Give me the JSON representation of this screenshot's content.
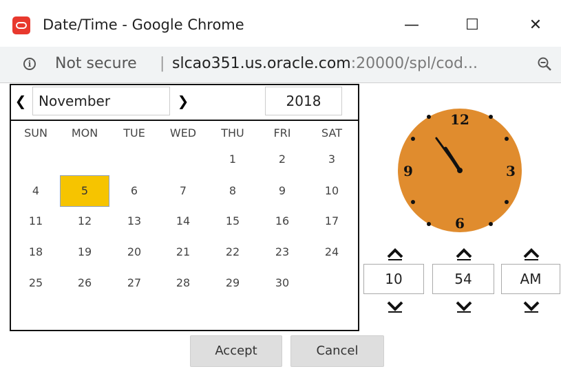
{
  "window": {
    "title": "Date/Time - Google Chrome",
    "minimize_glyph": "—",
    "maximize_glyph": "☐",
    "close_glyph": "✕"
  },
  "address": {
    "security_text": "Not secure",
    "separator": "|",
    "url_host": "slcao351.us.oracle.com",
    "url_rest": ":20000/spl/cod..."
  },
  "calendar": {
    "month": "November",
    "year": "2018",
    "prev_glyph": "❮",
    "next_glyph": "❯",
    "weekdays": [
      "SUN",
      "MON",
      "TUE",
      "WED",
      "THU",
      "FRI",
      "SAT"
    ],
    "weeks": [
      [
        "",
        "",
        "",
        "",
        "1",
        "2",
        "3"
      ],
      [
        "4",
        "5",
        "6",
        "7",
        "8",
        "9",
        "10"
      ],
      [
        "11",
        "12",
        "13",
        "14",
        "15",
        "16",
        "17"
      ],
      [
        "18",
        "19",
        "20",
        "21",
        "22",
        "23",
        "24"
      ],
      [
        "25",
        "26",
        "27",
        "28",
        "29",
        "30",
        ""
      ]
    ],
    "selected_day": "5",
    "selected_color": "#f6c400"
  },
  "clock": {
    "face_color": "#e08c2e",
    "numerals": {
      "twelve": "12",
      "three": "3",
      "six": "6",
      "nine": "9"
    },
    "hour": 10,
    "minute": 54
  },
  "time": {
    "hour": "10",
    "minute": "54",
    "ampm": "AM"
  },
  "buttons": {
    "accept": "Accept",
    "cancel": "Cancel"
  },
  "icons": {
    "app": "oracle-icon",
    "info": "info-icon",
    "zoom": "zoom-out-icon"
  }
}
